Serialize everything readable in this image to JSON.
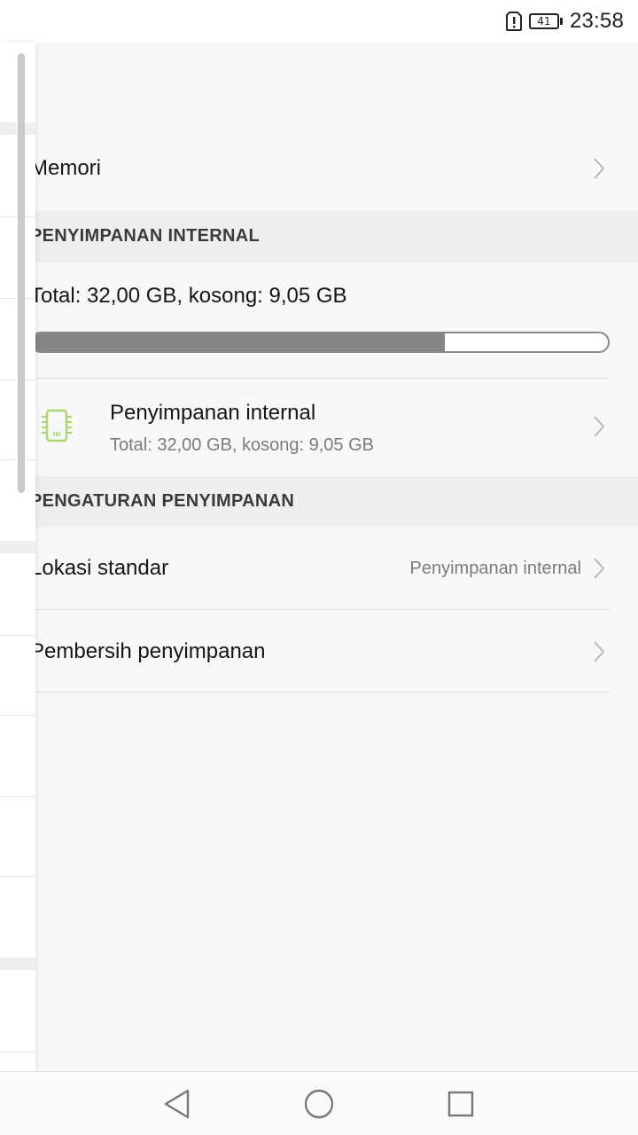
{
  "status_bar": {
    "battery_level": "41",
    "time": "23:58",
    "icons": [
      "sim-alert-icon",
      "battery-icon"
    ]
  },
  "memory_row": {
    "label": "Memori"
  },
  "internal_section": {
    "header": "PENYIMPANAN INTERNAL",
    "total_text": "Total: 32,00 GB, kosong: 9,05 GB",
    "used_fraction": 0.717
  },
  "internal_item": {
    "title": "Penyimpanan internal",
    "subtitle": "Total: 32,00 GB, kosong: 9,05 GB",
    "icon": "storage-chip-icon",
    "icon_color": "#a8d86e"
  },
  "settings_section": {
    "header": "PENGATURAN PENYIMPANAN",
    "default_location": {
      "label": "Lokasi standar",
      "value": "Penyimpanan internal"
    },
    "cleaner": {
      "label": "Pembersih penyimpanan"
    }
  },
  "nav_bar": {
    "icons": [
      "back-icon",
      "home-icon",
      "recents-icon"
    ]
  }
}
